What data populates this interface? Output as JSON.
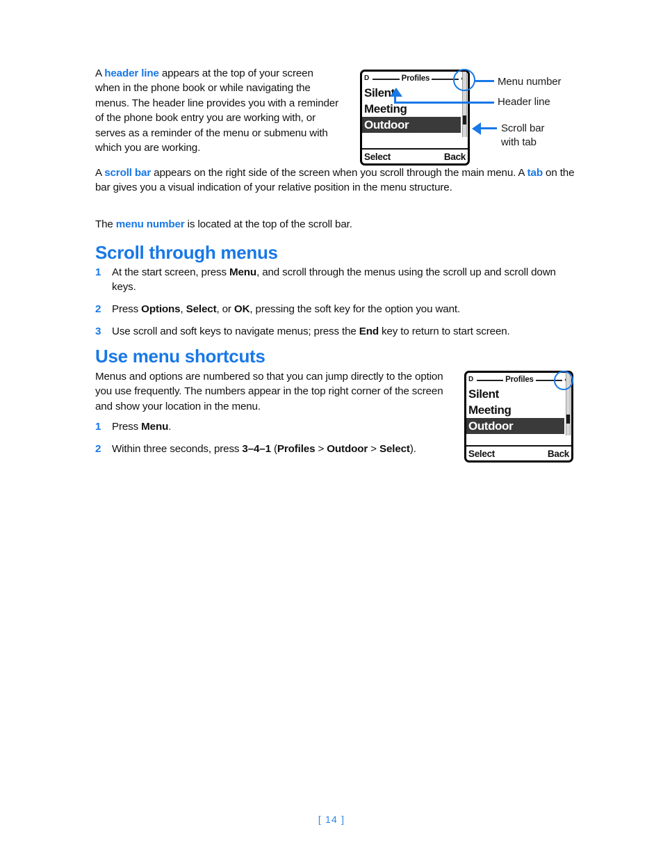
{
  "page": {
    "number_label": "[ 14 ]"
  },
  "intro": {
    "para1": {
      "prefix": "A ",
      "term": "header line",
      "rest": " appears at the top of your screen when in the phone book or while navigating the menus. The header line provides you with a reminder of the phone book entry you are working with, or serves as a reminder of the menu or submenu with which you are working."
    },
    "para2": {
      "prefix": "A ",
      "term": "scroll bar",
      "mid": " appears on the right side of the screen when you scroll through the main menu. A ",
      "term2": "tab",
      "rest": " on the bar gives you a visual indication of your relative position in the menu structure."
    },
    "para3": {
      "prefix": "The ",
      "term": "menu number",
      "rest": " is located at the top of the scroll bar."
    }
  },
  "figure_top": {
    "annotations": [
      {
        "label": "Menu number"
      },
      {
        "label": "Header line"
      },
      {
        "label_line1": "Scroll bar",
        "label_line2": "with tab"
      }
    ]
  },
  "phone_screen": {
    "header": {
      "signal_icon": "signal-indicator",
      "signal_glyph": "D",
      "title": "Profiles",
      "menu_number": "4"
    },
    "items": [
      {
        "label": "Silent",
        "selected": false
      },
      {
        "label": "Meeting",
        "selected": false
      },
      {
        "label": "Outdoor",
        "selected": true
      }
    ],
    "softkeys": {
      "left": "Select",
      "right": "Back"
    }
  },
  "section_scroll": {
    "heading": "Scroll through menus",
    "steps": [
      {
        "num": "1",
        "parts": [
          {
            "t": "At the start screen, press ",
            "b": false
          },
          {
            "t": "Menu",
            "b": true
          },
          {
            "t": ", and scroll through the menus using the scroll up and scroll down keys.",
            "b": false
          }
        ]
      },
      {
        "num": "2",
        "parts": [
          {
            "t": "Press ",
            "b": false
          },
          {
            "t": "Options",
            "b": true
          },
          {
            "t": ", ",
            "b": false
          },
          {
            "t": "Select",
            "b": true
          },
          {
            "t": ", or ",
            "b": false
          },
          {
            "t": "OK",
            "b": true
          },
          {
            "t": ", pressing the soft key for the option you want.",
            "b": false
          }
        ]
      },
      {
        "num": "3",
        "parts": [
          {
            "t": "Use scroll and soft keys to navigate menus; press the ",
            "b": false
          },
          {
            "t": "End",
            "b": true
          },
          {
            "t": " key to return to start screen.",
            "b": false
          }
        ]
      }
    ]
  },
  "section_shortcuts": {
    "heading": "Use menu shortcuts",
    "body": "Menus and options are numbered so that you can jump directly to the option you use frequently. The numbers appear in the top right corner of the screen and show your location in the menu.",
    "steps": [
      {
        "num": "1",
        "parts": [
          {
            "t": "Press ",
            "b": false
          },
          {
            "t": "Menu",
            "b": true
          },
          {
            "t": ".",
            "b": false
          }
        ]
      },
      {
        "num": "2",
        "parts": [
          {
            "t": "Within three seconds, press ",
            "b": false
          },
          {
            "t": "3–4–1",
            "b": true
          },
          {
            "t": " (",
            "b": false
          },
          {
            "t": "Profiles",
            "b": true
          },
          {
            "t": " > ",
            "b": false
          },
          {
            "t": "Outdoor",
            "b": true
          },
          {
            "t": " > ",
            "b": false
          },
          {
            "t": "Select",
            "b": true
          },
          {
            "t": ").",
            "b": false
          }
        ]
      }
    ]
  },
  "colors": {
    "accent_blue": "#1878e6",
    "page_number_blue": "#2a86ea",
    "selected_row": "#3a3a3a"
  }
}
